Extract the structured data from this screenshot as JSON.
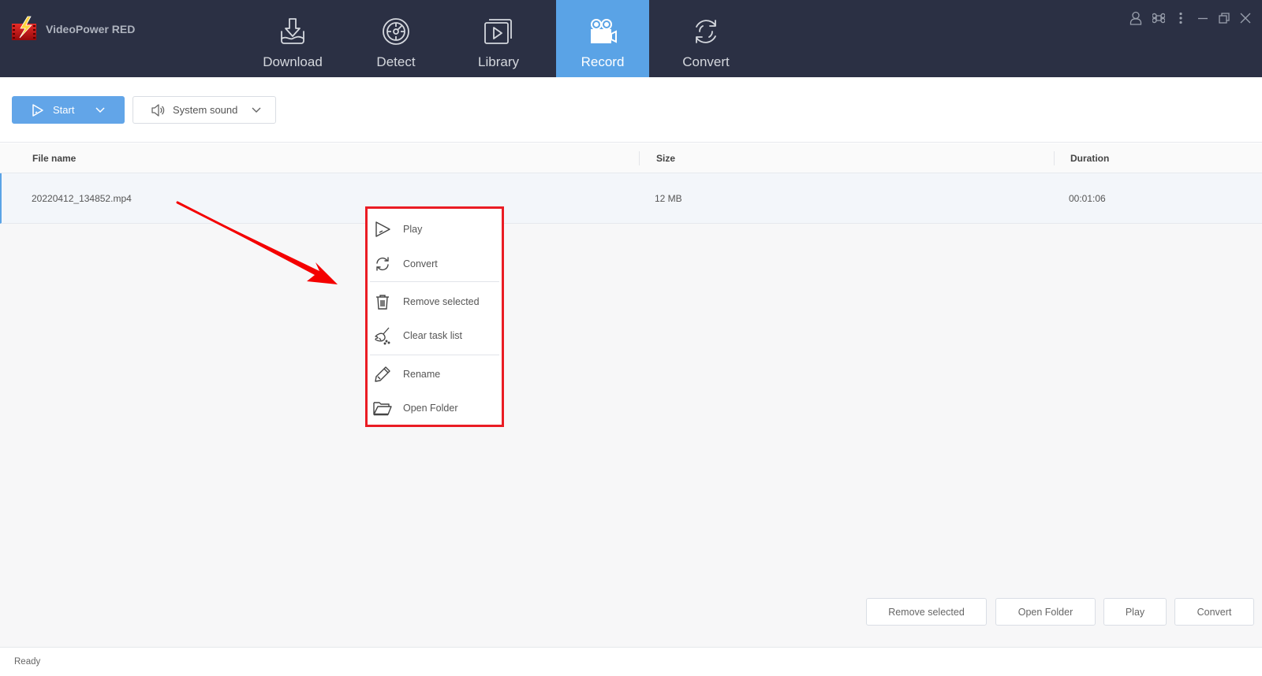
{
  "app": {
    "title": "VideoPower RED"
  },
  "nav": {
    "tabs": [
      {
        "label": "Download",
        "icon": "download-icon",
        "active": false
      },
      {
        "label": "Detect",
        "icon": "detect-icon",
        "active": false
      },
      {
        "label": "Library",
        "icon": "library-icon",
        "active": false
      },
      {
        "label": "Record",
        "icon": "record-camera-icon",
        "active": true
      },
      {
        "label": "Convert",
        "icon": "convert-icon",
        "active": false
      }
    ],
    "active_color": "#5aa3e6"
  },
  "window_controls": [
    "user-icon",
    "command-icon",
    "more-icon",
    "minimize-icon",
    "restore-icon",
    "close-icon"
  ],
  "toolbar": {
    "start_label": "Start",
    "sound_label": "System sound"
  },
  "table": {
    "columns": [
      "File name",
      "Size",
      "Duration"
    ],
    "rows": [
      {
        "file_name": "20220412_134852.mp4",
        "size": "12 MB",
        "duration": "00:01:06"
      }
    ]
  },
  "context_menu": {
    "items": [
      {
        "label": "Play",
        "icon": "play-icon"
      },
      {
        "label": "Convert",
        "icon": "convert-icon"
      },
      {
        "label": "Remove selected",
        "icon": "trash-icon"
      },
      {
        "label": "Clear task list",
        "icon": "broom-icon"
      },
      {
        "label": "Rename",
        "icon": "pencil-icon"
      },
      {
        "label": "Open Folder",
        "icon": "folder-icon"
      }
    ],
    "highlight_color": "#ea1c24"
  },
  "bottom_buttons": {
    "remove_selected": "Remove selected",
    "open_folder": "Open Folder",
    "play": "Play",
    "convert": "Convert"
  },
  "status": {
    "text": "Ready"
  }
}
